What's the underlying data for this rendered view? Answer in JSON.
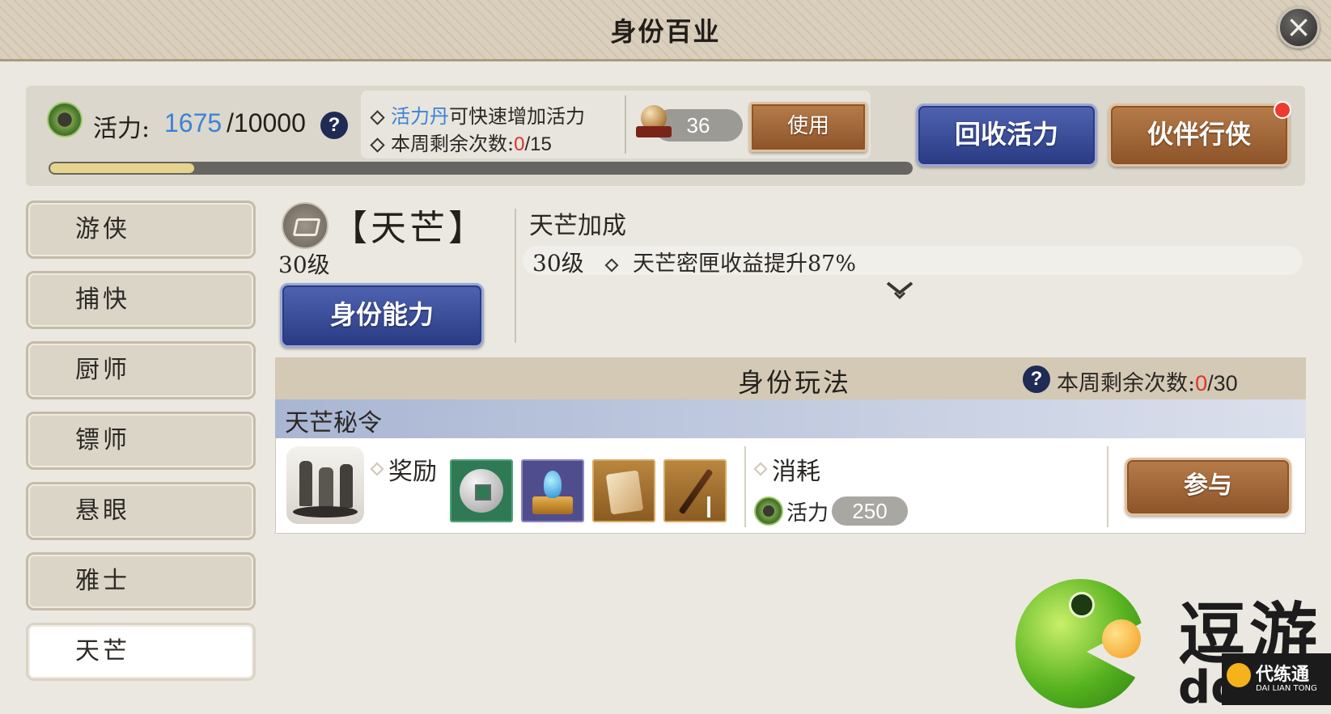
{
  "window": {
    "title": "身份百业",
    "close_icon": "×"
  },
  "vitality": {
    "label": "活力:",
    "current": "1675",
    "max": "/10000",
    "progress": 0.167,
    "help": "?",
    "tip_item": "活力丹",
    "tip_text": "可快速增加活力",
    "weekly_label": "本周剩余次数:",
    "weekly_used": "0",
    "weekly_total": "/15",
    "item_count": "36",
    "use_label": "使用",
    "recycle_label": "回收活力",
    "partner_label": "伙伴行侠"
  },
  "sidebar": {
    "items": [
      {
        "label": "游侠"
      },
      {
        "label": "捕快"
      },
      {
        "label": "厨师"
      },
      {
        "label": "镖师"
      },
      {
        "label": "悬眼"
      },
      {
        "label": "雅士"
      },
      {
        "label": "天芒"
      }
    ],
    "active_index": 6
  },
  "identity": {
    "name": "【天芒】",
    "level": "30级",
    "ability_label": "身份能力",
    "bonus_title": "天芒加成",
    "bonus_level": "30级",
    "bonus_text": "天芒密匣收益提升87%"
  },
  "play": {
    "title": "身份玩法",
    "help": "?",
    "weekly_label": "本周剩余次数:",
    "weekly_used": "0",
    "weekly_total": "/30",
    "task": {
      "name": "天芒秘令",
      "reward_label": "奖励",
      "rewards": [
        "coin-icon",
        "crystal-chest-icon",
        "scroll-icon",
        "sword-icon"
      ],
      "cost_label": "消耗",
      "cost_item": "活力",
      "cost_value": "250",
      "join_label": "参与"
    }
  },
  "colors": {
    "accent_blue": "#3c82d6",
    "count_red": "#d9362b",
    "brown_btn": "#a16638",
    "blue_btn": "#3a4d9a"
  },
  "watermark": {
    "text": "逗游",
    "sub": "do",
    "badge_text": "代练通",
    "badge_sub": "DAI LIAN TONG"
  }
}
